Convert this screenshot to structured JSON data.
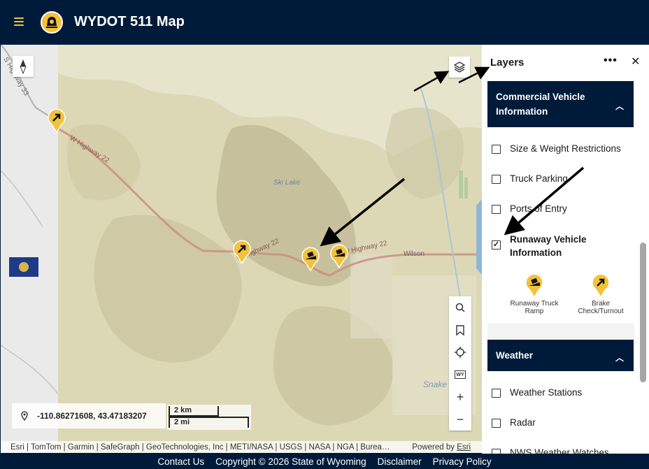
{
  "header": {
    "title": "WYDOT 511 Map"
  },
  "map": {
    "labels": {
      "highway_33": "S Highway 33",
      "highway_22_a": "W Highway 22",
      "highway_22_b": "W Highway 22",
      "highway_22_c": "W Highway 22",
      "ski_lake": "Ski Lake",
      "wilson": "Wilson",
      "snake_river": "Snake River"
    },
    "coordinates": "-110.86271608, 43.47183207",
    "scale": {
      "km": "2 km",
      "mi": "2 mi"
    },
    "attribution": "Esri | TomTom | Garmin | SafeGraph | GeoTechnologies, Inc | METI/NASA | USGS | NASA | NGA | Burea…",
    "powered_by": "Powered by",
    "powered_by_link": "Esri",
    "tools": [
      "search-icon",
      "bookmark-icon",
      "locate-icon",
      "wy-icon",
      "zoom-in-icon",
      "zoom-out-icon"
    ]
  },
  "layers_panel": {
    "title": "Layers",
    "more": "•••",
    "close": "✕",
    "sections": [
      {
        "title": "Commercial Vehicle Information",
        "items": [
          {
            "label": "Size & Weight Restrictions",
            "checked": false
          },
          {
            "label": "Truck Parking",
            "checked": false
          },
          {
            "label": "Ports of Entry",
            "checked": false
          },
          {
            "label": "Runaway Vehicle Information",
            "checked": true
          }
        ],
        "legend": [
          {
            "label": "Runaway Truck Ramp"
          },
          {
            "label": "Brake Check/Turnout"
          }
        ]
      },
      {
        "title": "Weather",
        "items": [
          {
            "label": "Weather Stations",
            "checked": false
          },
          {
            "label": "Radar",
            "checked": false
          },
          {
            "label": "NWS Weather Watches",
            "checked": false
          }
        ]
      }
    ]
  },
  "footer": {
    "contact": "Contact Us",
    "copyright": "Copyright © 2026 State of Wyoming",
    "disclaimer": "Disclaimer",
    "privacy": "Privacy Policy"
  },
  "colors": {
    "navy": "#001b3a",
    "marker_yellow": "#f2c23c",
    "terrain": "#d9d6b4"
  }
}
